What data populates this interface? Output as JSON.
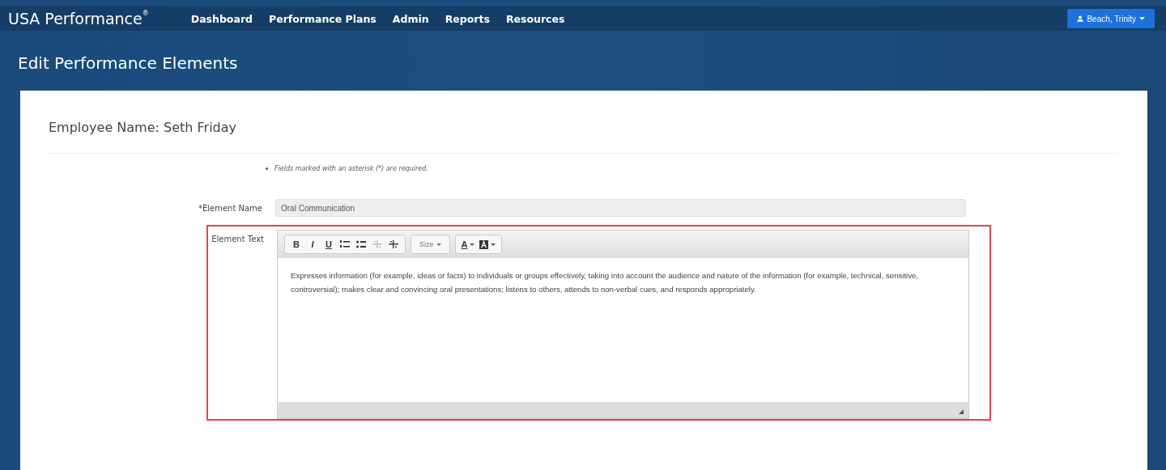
{
  "brand": {
    "name": "USA Performance",
    "mark": "®"
  },
  "nav": [
    {
      "label": "Dashboard"
    },
    {
      "label": "Performance Plans"
    },
    {
      "label": "Admin"
    },
    {
      "label": "Reports"
    },
    {
      "label": "Resources"
    }
  ],
  "user_menu": {
    "label": "Beach, Trinity"
  },
  "page_title": "Edit Performance Elements",
  "employee": "Employee Name: Seth Friday",
  "note": "Fields marked with an asterisk (*) are required.",
  "element_name": {
    "label": "Element Name",
    "required_mark": "*",
    "value": "Oral Communication"
  },
  "element_text": {
    "label": "Element Text",
    "highlighted": true,
    "toolbar": [
      [
        {
          "kind": "bold",
          "text": "B",
          "disabled": false
        },
        {
          "kind": "italic",
          "text": "I",
          "disabled": false
        },
        {
          "kind": "underline",
          "text": "U",
          "disabled": false
        },
        {
          "kind": "ordered-list",
          "disabled": false
        },
        {
          "kind": "bullet-list",
          "disabled": false
        },
        {
          "kind": "outdent",
          "disabled": true
        },
        {
          "kind": "indent",
          "disabled": false
        }
      ],
      [
        {
          "kind": "size",
          "text": "Size",
          "disabled": false
        }
      ],
      [
        {
          "kind": "font-color",
          "text": "A",
          "disabled": false
        },
        {
          "kind": "background-color",
          "disabled": false
        }
      ]
    ],
    "value": "Expresses information (for example, ideas or facts) to individuals or groups effectively, taking into account the audience and nature of the information (for example, technical, sensitive, controversial); makes clear and convincing oral presentations; listens to others, attends to non-verbal cues, and responds appropriately."
  }
}
